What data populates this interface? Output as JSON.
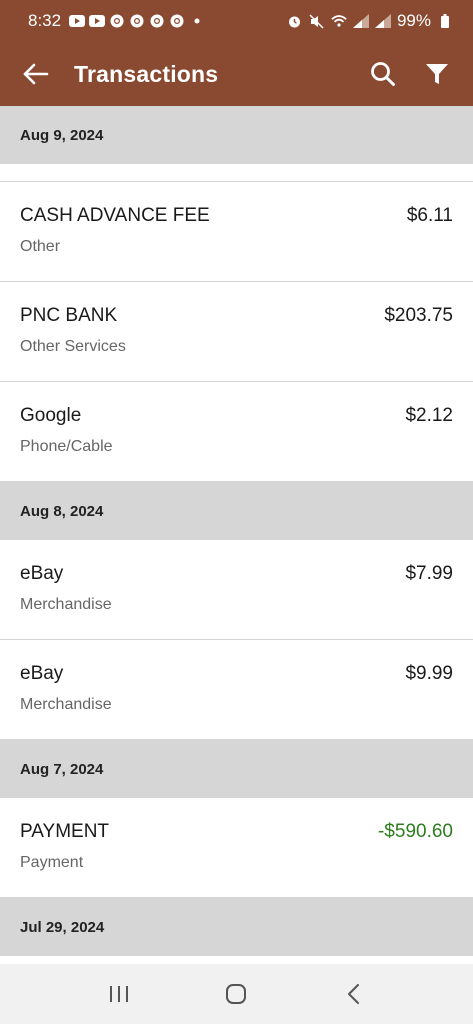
{
  "status_bar": {
    "time": "8:32",
    "battery": "99%",
    "left_icons": [
      "youtube-icon",
      "youtube-icon",
      "chrome-icon",
      "chrome-icon",
      "chrome-icon",
      "chrome-icon",
      "dot-icon"
    ],
    "right_icons": [
      "alarm-icon",
      "mute-icon",
      "wifi-icon",
      "signal-icon",
      "signal-icon",
      "battery-icon"
    ]
  },
  "header": {
    "title": "Transactions",
    "background": "#8a4a31"
  },
  "colors": {
    "credit": "#2e7d1f",
    "section_bg": "#d6d6d6"
  },
  "groups": [
    {
      "date": "Aug 9, 2024",
      "transactions": [
        {
          "merchant": "CASH ADVANCE FEE",
          "category": "Other",
          "amount": "$6.11"
        },
        {
          "merchant": "PNC BANK",
          "category": "Other Services",
          "amount": "$203.75"
        },
        {
          "merchant": "Google",
          "category": "Phone/Cable",
          "amount": "$2.12"
        }
      ]
    },
    {
      "date": "Aug 8, 2024",
      "transactions": [
        {
          "merchant": "eBay",
          "category": "Merchandise",
          "amount": "$7.99"
        },
        {
          "merchant": "eBay",
          "category": "Merchandise",
          "amount": "$9.99"
        }
      ]
    },
    {
      "date": "Aug 7, 2024",
      "transactions": [
        {
          "merchant": "PAYMENT",
          "category": "Payment",
          "amount": "-$590.60"
        }
      ]
    },
    {
      "date": "Jul 29, 2024",
      "transactions": []
    }
  ]
}
